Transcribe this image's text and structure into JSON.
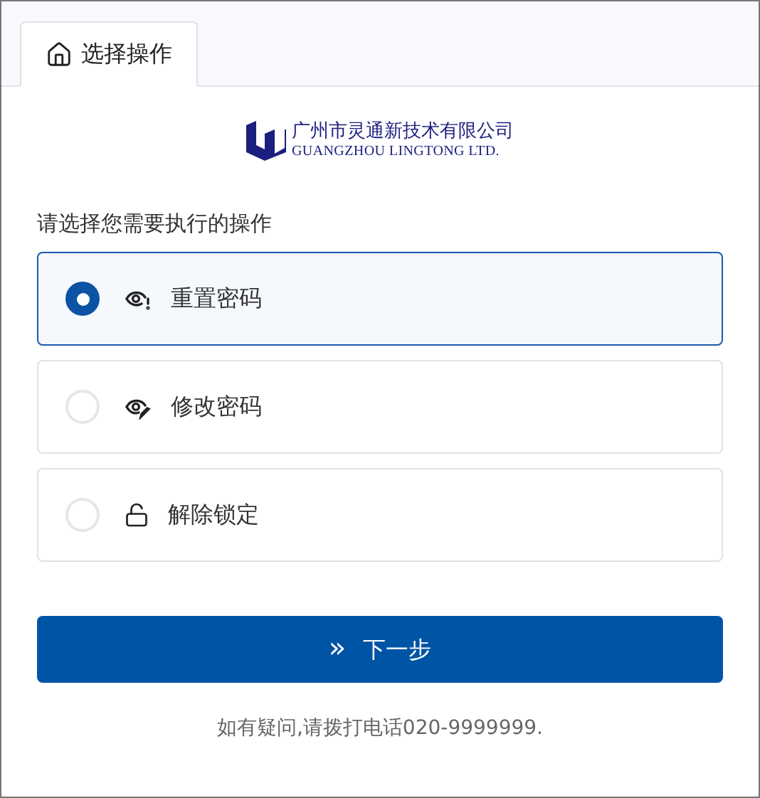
{
  "tabs": [
    {
      "label": "选择操作",
      "selected": true
    }
  ],
  "logo": {
    "name_zh": "广州市灵通新技术有限公司",
    "name_en": "GUANGZHOU LINGTONG LTD."
  },
  "prompt": "请选择您需要执行的操作",
  "options": [
    {
      "label": "重置密码",
      "kind": "reset",
      "selected": true
    },
    {
      "label": "修改密码",
      "kind": "change",
      "selected": false
    },
    {
      "label": "解除锁定",
      "kind": "unlock",
      "selected": false
    }
  ],
  "next_button": {
    "icon": "»",
    "label": "下一步"
  },
  "footer": "如有疑问,请拨打电话020-9999999."
}
